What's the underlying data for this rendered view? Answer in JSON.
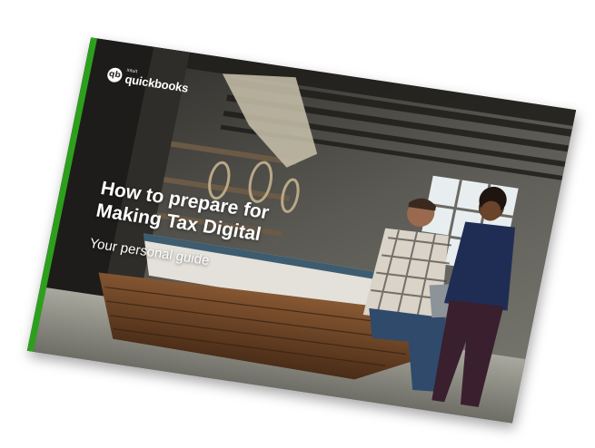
{
  "brand": {
    "logo_small": "intuit",
    "logo_main": "quickbooks",
    "logo_icon": "qb-logo-icon",
    "accent_color": "#2ca01c"
  },
  "cover": {
    "headline_line1": "How to prepare for",
    "headline_line2": "Making Tax Digital",
    "subtitle": "Your personal guide"
  }
}
